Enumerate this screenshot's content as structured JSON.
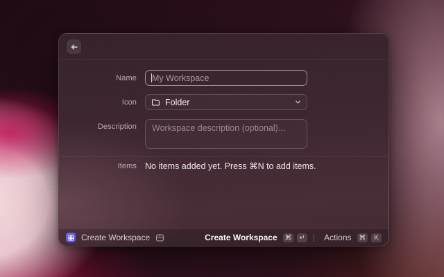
{
  "dialog": {
    "form": {
      "name": {
        "label": "Name",
        "placeholder": "My Workspace"
      },
      "icon": {
        "label": "Icon",
        "value": "Folder"
      },
      "description": {
        "label": "Description",
        "placeholder": "Workspace description (optional)..."
      },
      "items": {
        "label": "Items",
        "empty_text": "No items added yet. Press ⌘N to add items."
      }
    },
    "footer": {
      "app_title": "Create Workspace",
      "primary": {
        "label": "Create Workspace",
        "keys": [
          "⌘",
          "↵"
        ]
      },
      "secondary": {
        "label": "Actions",
        "keys": [
          "⌘",
          "K"
        ]
      }
    }
  },
  "icons": {
    "back": "arrow-left",
    "field_icon": "folder",
    "select_indicator": "chevron-down",
    "app": "grid-app-icon",
    "save": "save"
  },
  "colors": {
    "accent_purple": "#5f55e8",
    "dialog_bg": "#3a242e",
    "background_pink": "#e8c4cc",
    "background_maroon": "#2a0f1b"
  }
}
